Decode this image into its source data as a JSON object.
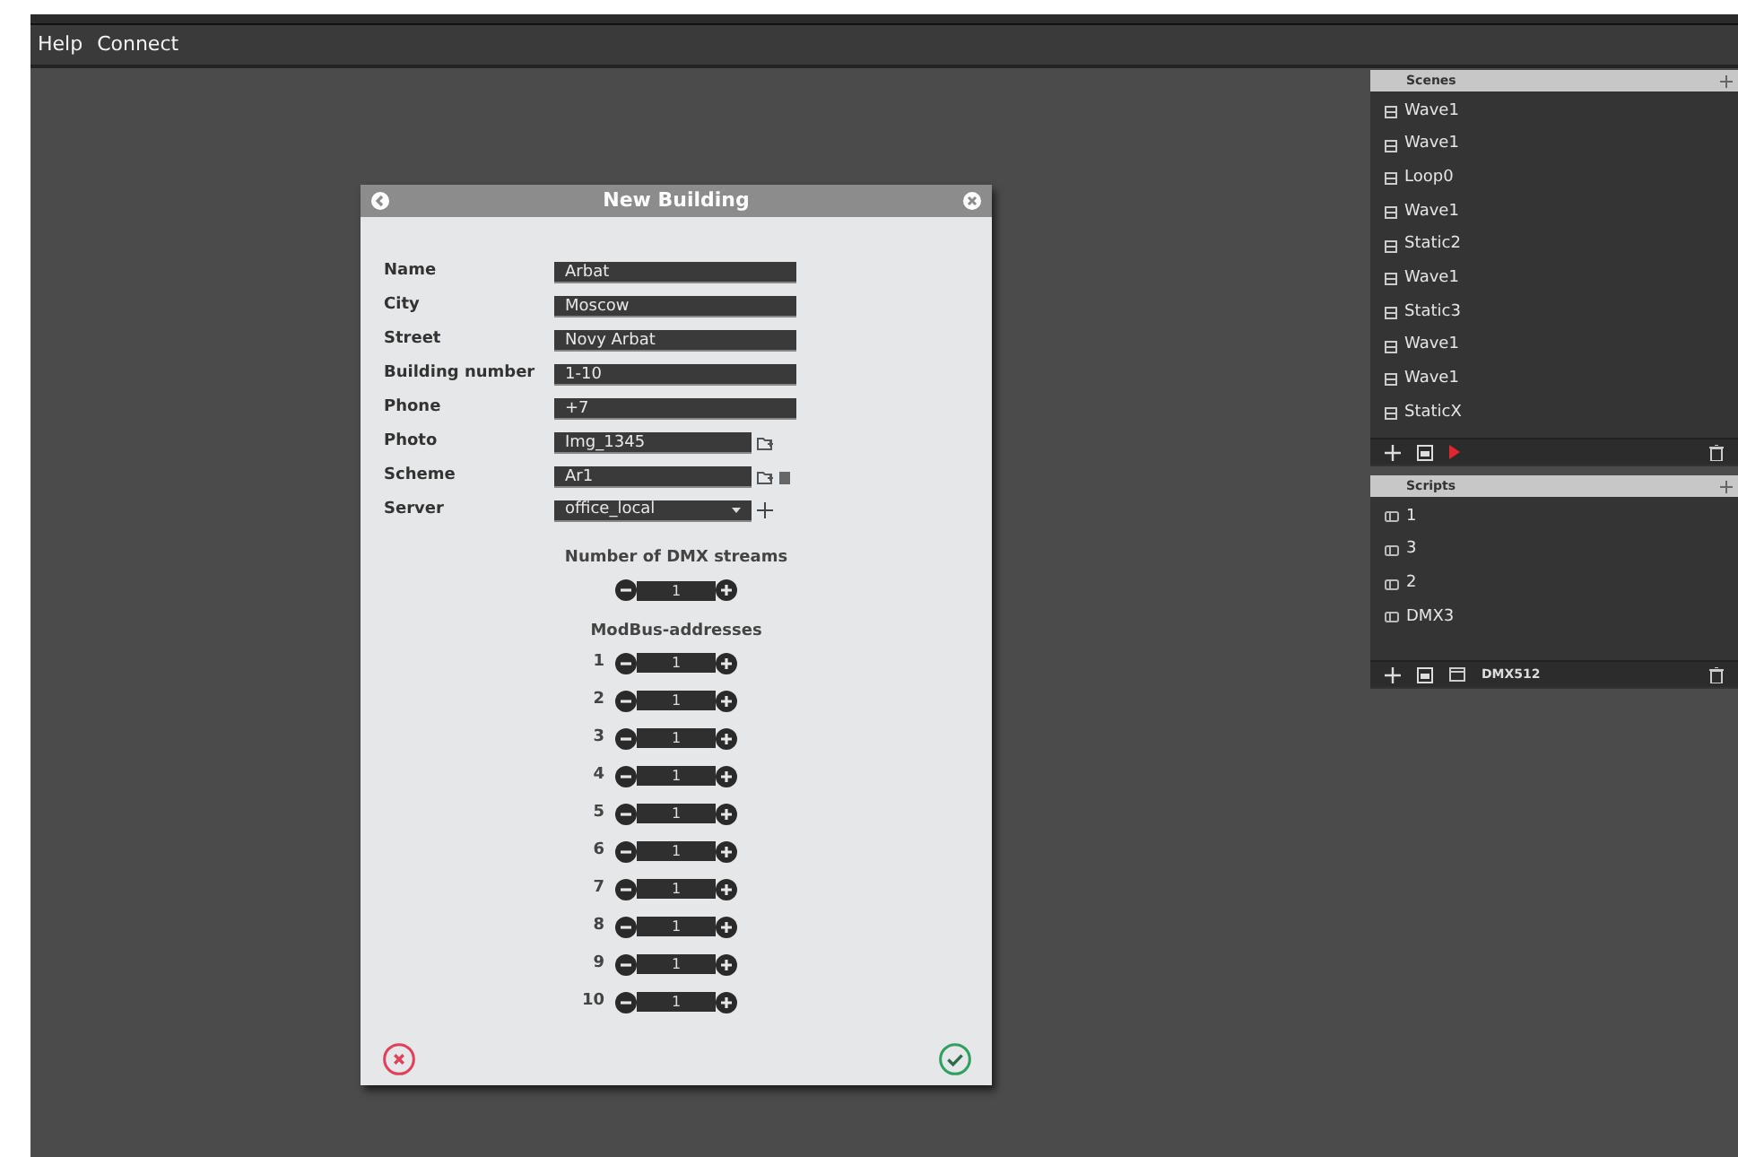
{
  "menu": [
    {
      "label": "Help"
    },
    {
      "label": "Connect"
    }
  ],
  "dialog": {
    "title": "New Building",
    "fields": [
      {
        "label": "Name",
        "value": "Arbat",
        "kind": "text"
      },
      {
        "label": "City",
        "value": "Moscow",
        "kind": "text"
      },
      {
        "label": "Street",
        "value": "Novy Arbat",
        "kind": "text"
      },
      {
        "label": "Building number",
        "value": "1-10",
        "kind": "text"
      },
      {
        "label": "Phone",
        "value": "+7",
        "kind": "text"
      },
      {
        "label": "Photo",
        "value": "Img_1345",
        "kind": "file"
      },
      {
        "label": "Scheme",
        "value": "Ar1",
        "kind": "file_clearable"
      },
      {
        "label": "Server",
        "value": "office_local",
        "kind": "select"
      }
    ],
    "dmx_streams": {
      "label": "Number of DMX streams",
      "value": "1"
    },
    "modbus": {
      "label": "ModBus-addresses",
      "rows": [
        {
          "index": "1",
          "value": "1"
        },
        {
          "index": "2",
          "value": "1"
        },
        {
          "index": "3",
          "value": "1"
        },
        {
          "index": "4",
          "value": "1"
        },
        {
          "index": "5",
          "value": "1"
        },
        {
          "index": "6",
          "value": "1"
        },
        {
          "index": "7",
          "value": "1"
        },
        {
          "index": "8",
          "value": "1"
        },
        {
          "index": "9",
          "value": "1"
        },
        {
          "index": "10",
          "value": "1"
        }
      ]
    }
  },
  "scenes": {
    "title": "Scenes",
    "items": [
      {
        "label": "Wave1"
      },
      {
        "label": "Wave1"
      },
      {
        "label": "Loop0"
      },
      {
        "label": "Wave1"
      },
      {
        "label": "Static2"
      },
      {
        "label": "Wave1"
      },
      {
        "label": "Static3"
      },
      {
        "label": "Wave1"
      },
      {
        "label": "Wave1"
      },
      {
        "label": "StaticX"
      }
    ]
  },
  "scripts": {
    "title": "Scripts",
    "items": [
      {
        "label": "1"
      },
      {
        "label": "3"
      },
      {
        "label": "2"
      },
      {
        "label": "DMX3"
      }
    ],
    "toolbar_label": "DMX512"
  }
}
